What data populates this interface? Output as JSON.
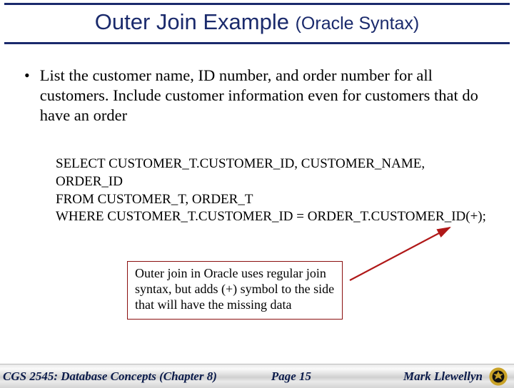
{
  "title": {
    "main": "Outer Join Example ",
    "sub": "(Oracle Syntax)"
  },
  "bullet": {
    "text": "List the customer name, ID number, and order number for all customers. Include customer information even for customers that do have an order"
  },
  "sql": {
    "line1": "SELECT CUSTOMER_T.CUSTOMER_ID, CUSTOMER_NAME, ORDER_ID",
    "line2": "FROM CUSTOMER_T,  ORDER_T",
    "line3": "WHERE CUSTOMER_T.CUSTOMER_ID = ORDER_T.CUSTOMER_ID(+);"
  },
  "callout": {
    "text": "Outer join in Oracle uses regular join syntax, but adds (+) symbol to the side that will have the missing data"
  },
  "footer": {
    "course": "CGS 2545: Database Concepts  (Chapter 8)",
    "page": "Page 15",
    "author": "Mark Llewellyn"
  },
  "colors": {
    "title": "#1a2a6c",
    "callout_border": "#8a0f0f",
    "arrow": "#b01818",
    "logo_gold": "#c9a227",
    "logo_black": "#111"
  }
}
